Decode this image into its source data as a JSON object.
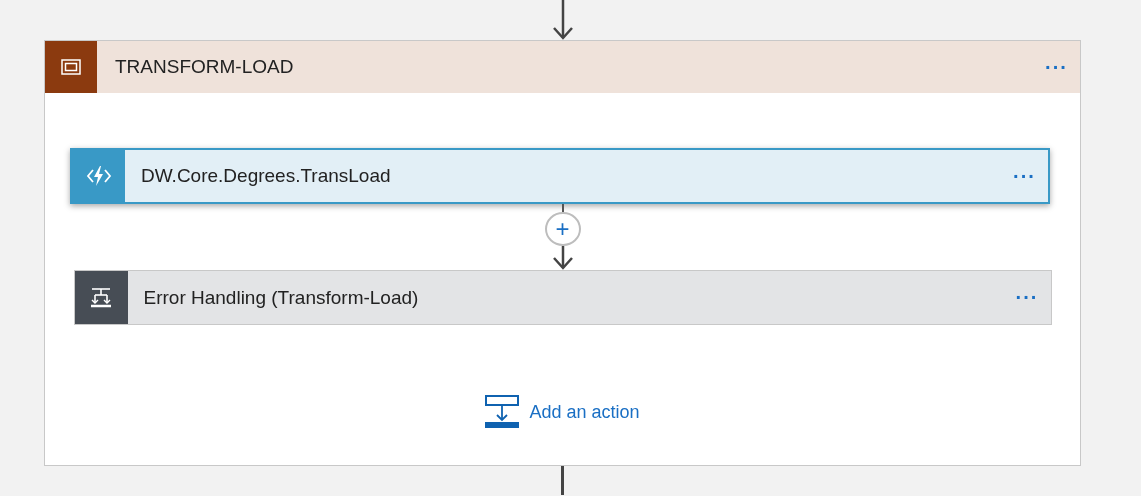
{
  "scope": {
    "title": "TRANSFORM-LOAD",
    "menu": "···",
    "actions": [
      {
        "kind": "function",
        "title": "DW.Core.Degrees.TransLoad",
        "menu": "···",
        "selected": true
      },
      {
        "kind": "condition",
        "title": "Error Handling (Transform-Load)",
        "menu": "···",
        "selected": false
      }
    ],
    "insert_button": "+",
    "add_action": "Add an action"
  }
}
